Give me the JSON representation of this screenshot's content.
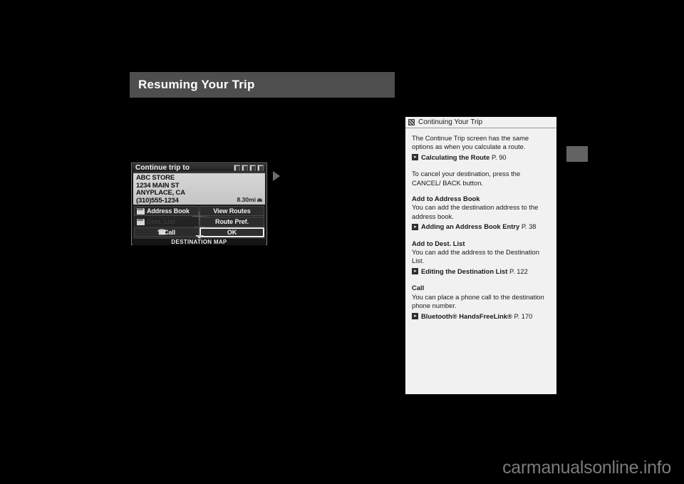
{
  "page": {
    "title": "Resuming Your Trip",
    "watermark": "carmanualsonline.info"
  },
  "nav_screen": {
    "header_title": "Continue trip to",
    "status_icons": [
      "signal-icon",
      "battery-icon",
      "media-icon",
      "phone-icon"
    ],
    "destination": {
      "name": "ABC STORE",
      "street": "1234 MAIN ST",
      "city_state": "ANYPLACE, CA",
      "phone": "(310)555-1234",
      "distance": "8.30mi"
    },
    "buttons": {
      "address_book": "Address Book",
      "address_book_badge": "ADD TO",
      "dest_list": "Dest. List",
      "dest_list_badge": "ADD TO",
      "call": "Call",
      "view_routes": "View Routes",
      "route_pref": "Route Pref.",
      "ok": "OK"
    },
    "footer": "DESTINATION MAP"
  },
  "info_panel": {
    "heading": "Continuing Your Trip",
    "intro": "The Continue Trip screen has the same options as when you calculate a route.",
    "intro_ref": {
      "label": "Calculating the Route",
      "page": "P. 90"
    },
    "cancel_note": "To cancel your destination, press the CANCEL/ BACK button.",
    "sections": [
      {
        "title": "Add to Address Book",
        "body": "You can add the destination address to the address book.",
        "ref": {
          "label": "Adding an Address Book Entry",
          "page": "P. 38"
        }
      },
      {
        "title": "Add to Dest. List",
        "body": "You can add the address to the Destination List.",
        "ref": {
          "label": "Editing the Destination List",
          "page": "P. 122"
        }
      },
      {
        "title": "Call",
        "body": "You can place a phone call to the destination phone number.",
        "ref": {
          "label": "Bluetooth® HandsFreeLink®",
          "page": "P. 170"
        }
      }
    ]
  }
}
